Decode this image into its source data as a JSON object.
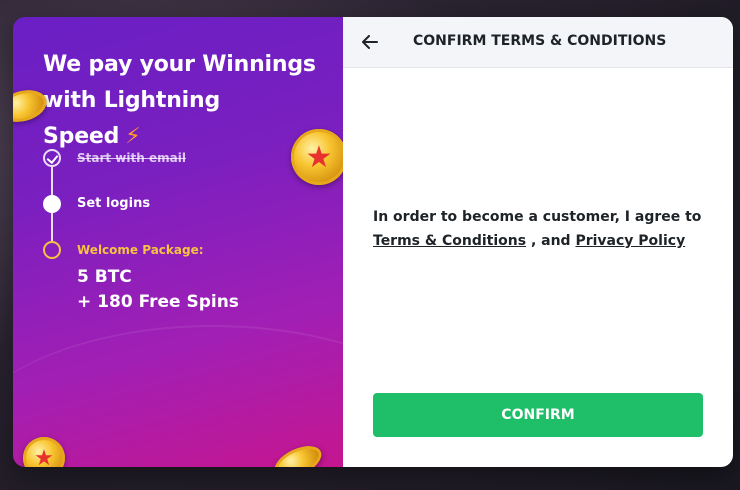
{
  "promo": {
    "title_line1": "We pay your Winnings",
    "title_line2": "with Lightning Speed",
    "bolt_icon": "⚡"
  },
  "steps": [
    {
      "label": "Start with email",
      "state": "done"
    },
    {
      "label": "Set logins",
      "state": "current"
    },
    {
      "label": "Welcome Package:",
      "state": "pending"
    }
  ],
  "bonus": {
    "line1": "5 BTC",
    "line2": "+ 180 Free Spins"
  },
  "dialog": {
    "title": "CONFIRM TERMS & CONDITIONS",
    "back_icon": "arrow-left-icon",
    "agree_text": "In order to become a customer, I agree to",
    "terms_link": "Terms & Conditions",
    "and_text": ", and",
    "privacy_link": "Privacy Policy",
    "confirm_label": "CONFIRM"
  },
  "colors": {
    "confirm_green": "#1fbf6a",
    "promo_gold": "#f5c242",
    "bolt_orange": "#ff9c2e"
  }
}
